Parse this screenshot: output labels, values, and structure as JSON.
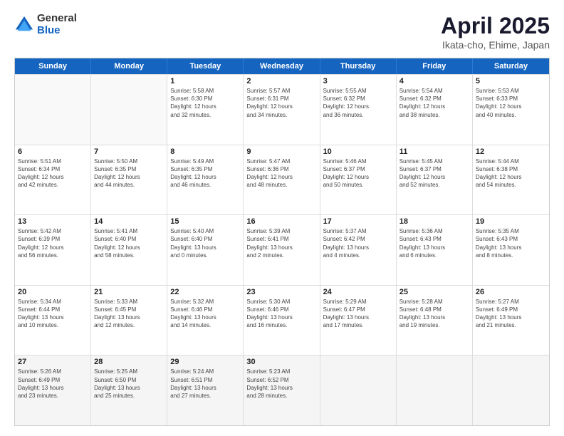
{
  "header": {
    "logo_general": "General",
    "logo_blue": "Blue",
    "title": "April 2025",
    "location": "Ikata-cho, Ehime, Japan"
  },
  "days_of_week": [
    "Sunday",
    "Monday",
    "Tuesday",
    "Wednesday",
    "Thursday",
    "Friday",
    "Saturday"
  ],
  "weeks": [
    [
      {
        "day": "",
        "info": ""
      },
      {
        "day": "",
        "info": ""
      },
      {
        "day": "1",
        "info": "Sunrise: 5:58 AM\nSunset: 6:30 PM\nDaylight: 12 hours\nand 32 minutes."
      },
      {
        "day": "2",
        "info": "Sunrise: 5:57 AM\nSunset: 6:31 PM\nDaylight: 12 hours\nand 34 minutes."
      },
      {
        "day": "3",
        "info": "Sunrise: 5:55 AM\nSunset: 6:32 PM\nDaylight: 12 hours\nand 36 minutes."
      },
      {
        "day": "4",
        "info": "Sunrise: 5:54 AM\nSunset: 6:32 PM\nDaylight: 12 hours\nand 38 minutes."
      },
      {
        "day": "5",
        "info": "Sunrise: 5:53 AM\nSunset: 6:33 PM\nDaylight: 12 hours\nand 40 minutes."
      }
    ],
    [
      {
        "day": "6",
        "info": "Sunrise: 5:51 AM\nSunset: 6:34 PM\nDaylight: 12 hours\nand 42 minutes."
      },
      {
        "day": "7",
        "info": "Sunrise: 5:50 AM\nSunset: 6:35 PM\nDaylight: 12 hours\nand 44 minutes."
      },
      {
        "day": "8",
        "info": "Sunrise: 5:49 AM\nSunset: 6:35 PM\nDaylight: 12 hours\nand 46 minutes."
      },
      {
        "day": "9",
        "info": "Sunrise: 5:47 AM\nSunset: 6:36 PM\nDaylight: 12 hours\nand 48 minutes."
      },
      {
        "day": "10",
        "info": "Sunrise: 5:46 AM\nSunset: 6:37 PM\nDaylight: 12 hours\nand 50 minutes."
      },
      {
        "day": "11",
        "info": "Sunrise: 5:45 AM\nSunset: 6:37 PM\nDaylight: 12 hours\nand 52 minutes."
      },
      {
        "day": "12",
        "info": "Sunrise: 5:44 AM\nSunset: 6:38 PM\nDaylight: 12 hours\nand 54 minutes."
      }
    ],
    [
      {
        "day": "13",
        "info": "Sunrise: 5:42 AM\nSunset: 6:39 PM\nDaylight: 12 hours\nand 56 minutes."
      },
      {
        "day": "14",
        "info": "Sunrise: 5:41 AM\nSunset: 6:40 PM\nDaylight: 12 hours\nand 58 minutes."
      },
      {
        "day": "15",
        "info": "Sunrise: 5:40 AM\nSunset: 6:40 PM\nDaylight: 13 hours\nand 0 minutes."
      },
      {
        "day": "16",
        "info": "Sunrise: 5:39 AM\nSunset: 6:41 PM\nDaylight: 13 hours\nand 2 minutes."
      },
      {
        "day": "17",
        "info": "Sunrise: 5:37 AM\nSunset: 6:42 PM\nDaylight: 13 hours\nand 4 minutes."
      },
      {
        "day": "18",
        "info": "Sunrise: 5:36 AM\nSunset: 6:43 PM\nDaylight: 13 hours\nand 6 minutes."
      },
      {
        "day": "19",
        "info": "Sunrise: 5:35 AM\nSunset: 6:43 PM\nDaylight: 13 hours\nand 8 minutes."
      }
    ],
    [
      {
        "day": "20",
        "info": "Sunrise: 5:34 AM\nSunset: 6:44 PM\nDaylight: 13 hours\nand 10 minutes."
      },
      {
        "day": "21",
        "info": "Sunrise: 5:33 AM\nSunset: 6:45 PM\nDaylight: 13 hours\nand 12 minutes."
      },
      {
        "day": "22",
        "info": "Sunrise: 5:32 AM\nSunset: 6:46 PM\nDaylight: 13 hours\nand 14 minutes."
      },
      {
        "day": "23",
        "info": "Sunrise: 5:30 AM\nSunset: 6:46 PM\nDaylight: 13 hours\nand 16 minutes."
      },
      {
        "day": "24",
        "info": "Sunrise: 5:29 AM\nSunset: 6:47 PM\nDaylight: 13 hours\nand 17 minutes."
      },
      {
        "day": "25",
        "info": "Sunrise: 5:28 AM\nSunset: 6:48 PM\nDaylight: 13 hours\nand 19 minutes."
      },
      {
        "day": "26",
        "info": "Sunrise: 5:27 AM\nSunset: 6:49 PM\nDaylight: 13 hours\nand 21 minutes."
      }
    ],
    [
      {
        "day": "27",
        "info": "Sunrise: 5:26 AM\nSunset: 6:49 PM\nDaylight: 13 hours\nand 23 minutes."
      },
      {
        "day": "28",
        "info": "Sunrise: 5:25 AM\nSunset: 6:50 PM\nDaylight: 13 hours\nand 25 minutes."
      },
      {
        "day": "29",
        "info": "Sunrise: 5:24 AM\nSunset: 6:51 PM\nDaylight: 13 hours\nand 27 minutes."
      },
      {
        "day": "30",
        "info": "Sunrise: 5:23 AM\nSunset: 6:52 PM\nDaylight: 13 hours\nand 28 minutes."
      },
      {
        "day": "",
        "info": ""
      },
      {
        "day": "",
        "info": ""
      },
      {
        "day": "",
        "info": ""
      }
    ]
  ]
}
